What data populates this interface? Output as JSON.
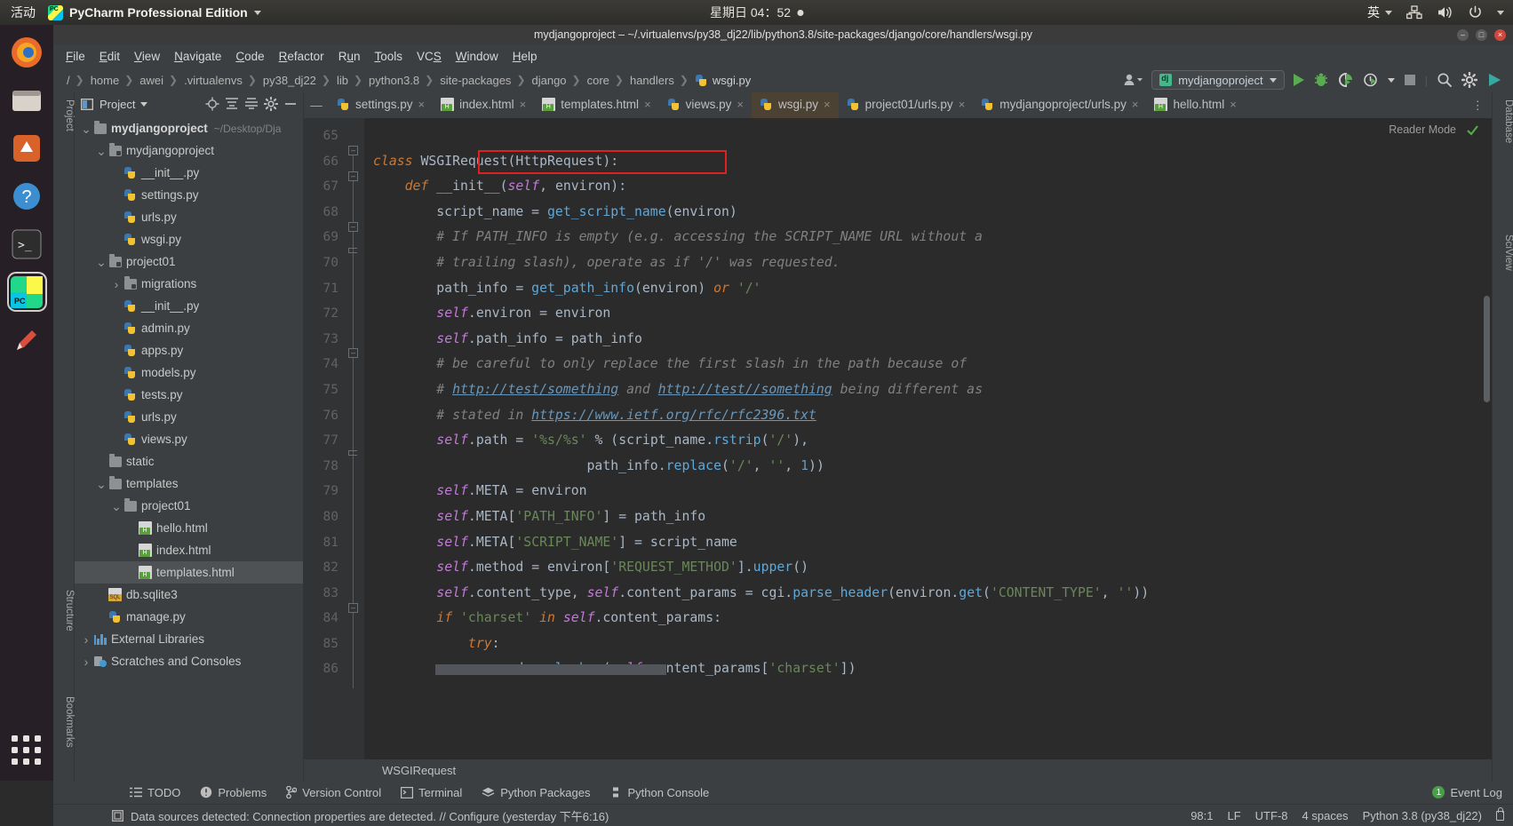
{
  "gnome_panel": {
    "activities": "活动",
    "app_name": "PyCharm Professional Edition",
    "app_icon": "pycharm-logo-icon",
    "clock": "星期日 04：52",
    "ime": "英",
    "network_icon": "network-icon",
    "volume_icon": "volume-icon",
    "power_icon": "power-icon"
  },
  "dock": {
    "items": [
      {
        "name": "firefox",
        "icon": "firefox-icon"
      },
      {
        "name": "files",
        "icon": "files-icon"
      },
      {
        "name": "software",
        "icon": "ubuntu-software-icon"
      },
      {
        "name": "help",
        "icon": "help-icon"
      },
      {
        "name": "terminal",
        "icon": "terminal-icon"
      },
      {
        "name": "pycharm",
        "icon": "pycharm-icon"
      },
      {
        "name": "text-editor",
        "icon": "text-editor-icon"
      }
    ],
    "show_apps_label": "show-applications"
  },
  "window": {
    "title": "mydjangoproject – ~/.virtualenvs/py38_dj22/lib/python3.8/site-packages/django/core/handlers/wsgi.py",
    "minimize": "–",
    "maximize": "□",
    "close": "×"
  },
  "menubar": {
    "items": [
      "File",
      "Edit",
      "View",
      "Navigate",
      "Code",
      "Refactor",
      "Run",
      "Tools",
      "VCS",
      "Window",
      "Help"
    ]
  },
  "navbar": {
    "crumbs": [
      {
        "label": "/",
        "icon": ""
      },
      {
        "label": "home",
        "icon": ""
      },
      {
        "label": "awei",
        "icon": ""
      },
      {
        "label": ".virtualenvs",
        "icon": ""
      },
      {
        "label": "py38_dj22",
        "icon": ""
      },
      {
        "label": "lib",
        "icon": ""
      },
      {
        "label": "python3.8",
        "icon": ""
      },
      {
        "label": "site-packages",
        "icon": ""
      },
      {
        "label": "django",
        "icon": ""
      },
      {
        "label": "core",
        "icon": ""
      },
      {
        "label": "handlers",
        "icon": ""
      },
      {
        "label": "wsgi.py",
        "icon": "python-file-icon"
      }
    ],
    "run_config": "mydjangoproject",
    "run_config_icon": "django-icon",
    "buttons": [
      {
        "name": "user-icon",
        "label": ""
      },
      {
        "name": "run-button",
        "label": ""
      },
      {
        "name": "debug-button",
        "label": ""
      },
      {
        "name": "coverage-button",
        "label": ""
      },
      {
        "name": "profile-button",
        "label": ""
      },
      {
        "name": "stop-button",
        "label": ""
      },
      {
        "name": "search-button",
        "label": ""
      },
      {
        "name": "settings-button",
        "label": ""
      },
      {
        "name": "updates-button",
        "label": ""
      }
    ]
  },
  "project_panel": {
    "title": "Project",
    "toolbar_icons": [
      "locate-icon",
      "expand-all-icon",
      "collapse-all-icon",
      "settings-icon",
      "hide-icon"
    ],
    "tree": [
      {
        "indent": 0,
        "arrow": "v",
        "icon": "folder-icon",
        "label": "mydjangoproject",
        "bold": true,
        "path": "~/Desktop/Dja",
        "selected": false
      },
      {
        "indent": 1,
        "arrow": "v",
        "icon": "folder-src-icon",
        "label": "mydjangoproject",
        "bold": false,
        "path": "",
        "selected": false
      },
      {
        "indent": 2,
        "arrow": "",
        "icon": "python-file-icon",
        "label": "__init__.py",
        "bold": false,
        "path": "",
        "selected": false
      },
      {
        "indent": 2,
        "arrow": "",
        "icon": "python-file-icon",
        "label": "settings.py",
        "bold": false,
        "path": "",
        "selected": false
      },
      {
        "indent": 2,
        "arrow": "",
        "icon": "python-file-icon",
        "label": "urls.py",
        "bold": false,
        "path": "",
        "selected": false
      },
      {
        "indent": 2,
        "arrow": "",
        "icon": "python-file-icon",
        "label": "wsgi.py",
        "bold": false,
        "path": "",
        "selected": false
      },
      {
        "indent": 1,
        "arrow": "v",
        "icon": "folder-src-icon",
        "label": "project01",
        "bold": false,
        "path": "",
        "selected": false
      },
      {
        "indent": 2,
        "arrow": ">",
        "icon": "folder-src-icon",
        "label": "migrations",
        "bold": false,
        "path": "",
        "selected": false
      },
      {
        "indent": 2,
        "arrow": "",
        "icon": "python-file-icon",
        "label": "__init__.py",
        "bold": false,
        "path": "",
        "selected": false
      },
      {
        "indent": 2,
        "arrow": "",
        "icon": "python-file-icon",
        "label": "admin.py",
        "bold": false,
        "path": "",
        "selected": false
      },
      {
        "indent": 2,
        "arrow": "",
        "icon": "python-file-icon",
        "label": "apps.py",
        "bold": false,
        "path": "",
        "selected": false
      },
      {
        "indent": 2,
        "arrow": "",
        "icon": "python-file-icon",
        "label": "models.py",
        "bold": false,
        "path": "",
        "selected": false
      },
      {
        "indent": 2,
        "arrow": "",
        "icon": "python-file-icon",
        "label": "tests.py",
        "bold": false,
        "path": "",
        "selected": false
      },
      {
        "indent": 2,
        "arrow": "",
        "icon": "python-file-icon",
        "label": "urls.py",
        "bold": false,
        "path": "",
        "selected": false
      },
      {
        "indent": 2,
        "arrow": "",
        "icon": "python-file-icon",
        "label": "views.py",
        "bold": false,
        "path": "",
        "selected": false
      },
      {
        "indent": 1,
        "arrow": "",
        "icon": "folder-icon",
        "label": "static",
        "bold": false,
        "path": "",
        "selected": false
      },
      {
        "indent": 1,
        "arrow": "v",
        "icon": "folder-icon",
        "label": "templates",
        "bold": false,
        "path": "",
        "selected": false
      },
      {
        "indent": 2,
        "arrow": "v",
        "icon": "folder-icon",
        "label": "project01",
        "bold": false,
        "path": "",
        "selected": false
      },
      {
        "indent": 3,
        "arrow": "",
        "icon": "html-file-icon",
        "label": "hello.html",
        "bold": false,
        "path": "",
        "selected": false
      },
      {
        "indent": 3,
        "arrow": "",
        "icon": "html-file-icon",
        "label": "index.html",
        "bold": false,
        "path": "",
        "selected": false
      },
      {
        "indent": 3,
        "arrow": "",
        "icon": "html-file-icon",
        "label": "templates.html",
        "bold": false,
        "path": "",
        "selected": true
      },
      {
        "indent": 1,
        "arrow": "",
        "icon": "sqlite-file-icon",
        "label": "db.sqlite3",
        "bold": false,
        "path": "",
        "selected": false
      },
      {
        "indent": 1,
        "arrow": "",
        "icon": "python-file-icon",
        "label": "manage.py",
        "bold": false,
        "path": "",
        "selected": false
      },
      {
        "indent": 0,
        "arrow": ">",
        "icon": "library-icon",
        "label": "External Libraries",
        "bold": false,
        "path": "",
        "selected": false
      },
      {
        "indent": 0,
        "arrow": ">",
        "icon": "scratches-icon",
        "label": "Scratches and Consoles",
        "bold": false,
        "path": "",
        "selected": false
      }
    ]
  },
  "left_strip_labels": [
    "Project",
    "Structure",
    "Bookmarks"
  ],
  "right_strip_labels": [
    "Database",
    "SciView"
  ],
  "editor": {
    "tabs": [
      {
        "label": "settings.py",
        "icon": "python-file-icon",
        "state": "normal"
      },
      {
        "label": "index.html",
        "icon": "html-file-icon",
        "state": "normal"
      },
      {
        "label": "templates.html",
        "icon": "html-file-icon",
        "state": "normal"
      },
      {
        "label": "views.py",
        "icon": "python-file-icon",
        "state": "normal"
      },
      {
        "label": "wsgi.py",
        "icon": "python-file-icon",
        "state": "current"
      },
      {
        "label": "project01/urls.py",
        "icon": "python-file-icon",
        "state": "normal"
      },
      {
        "label": "mydjangoproject/urls.py",
        "icon": "python-file-icon",
        "state": "normal"
      },
      {
        "label": "hello.html",
        "icon": "html-file-icon",
        "state": "normal"
      }
    ],
    "reader_mode": "Reader Mode",
    "first_line_number": 65,
    "lines": [
      {
        "n": 65,
        "tokens": []
      },
      {
        "n": 66,
        "tokens": [
          {
            "t": "class ",
            "c": "kwi"
          },
          {
            "t": "WSGIRequest",
            "c": "pl"
          },
          {
            "t": "(",
            "c": "pl"
          },
          {
            "t": "HttpRequest",
            "c": "pl"
          },
          {
            "t": "):",
            "c": "pl"
          }
        ]
      },
      {
        "n": 67,
        "tokens": [
          {
            "t": "    ",
            "c": "pl"
          },
          {
            "t": "def ",
            "c": "kwi"
          },
          {
            "t": "__init__",
            "c": "pl"
          },
          {
            "t": "(",
            "c": "pl"
          },
          {
            "t": "self",
            "c": "self"
          },
          {
            "t": ", environ):",
            "c": "pl"
          }
        ]
      },
      {
        "n": 68,
        "tokens": [
          {
            "t": "        script_name = ",
            "c": "pl"
          },
          {
            "t": "get_script_name",
            "c": "fn"
          },
          {
            "t": "(environ)",
            "c": "pl"
          }
        ]
      },
      {
        "n": 69,
        "tokens": [
          {
            "t": "        # If PATH_INFO is empty (e.g. accessing the SCRIPT_NAME URL without a",
            "c": "cm"
          }
        ]
      },
      {
        "n": 70,
        "tokens": [
          {
            "t": "        # trailing slash), operate as if '/' was requested.",
            "c": "cm"
          }
        ]
      },
      {
        "n": 71,
        "tokens": [
          {
            "t": "        path_info = ",
            "c": "pl"
          },
          {
            "t": "get_path_info",
            "c": "fn"
          },
          {
            "t": "(environ) ",
            "c": "pl"
          },
          {
            "t": "or ",
            "c": "kwi"
          },
          {
            "t": "'/'",
            "c": "str"
          }
        ]
      },
      {
        "n": 72,
        "tokens": [
          {
            "t": "        ",
            "c": "pl"
          },
          {
            "t": "self",
            "c": "self"
          },
          {
            "t": ".environ = environ",
            "c": "pl"
          }
        ]
      },
      {
        "n": 73,
        "tokens": [
          {
            "t": "        ",
            "c": "pl"
          },
          {
            "t": "self",
            "c": "self"
          },
          {
            "t": ".path_info = path_info",
            "c": "pl"
          }
        ]
      },
      {
        "n": 74,
        "tokens": [
          {
            "t": "        # be careful to only replace the first slash in the path because of",
            "c": "cm"
          }
        ]
      },
      {
        "n": 75,
        "tokens": [
          {
            "t": "        # ",
            "c": "cm"
          },
          {
            "t": "http://test/something",
            "c": "lnk"
          },
          {
            "t": " and ",
            "c": "cm"
          },
          {
            "t": "http://test//something",
            "c": "lnk"
          },
          {
            "t": " being different as",
            "c": "cm"
          }
        ]
      },
      {
        "n": 76,
        "tokens": [
          {
            "t": "        # stated in ",
            "c": "cm"
          },
          {
            "t": "https://www.ietf.org/rfc/rfc2396.txt",
            "c": "lnk"
          }
        ]
      },
      {
        "n": 77,
        "tokens": [
          {
            "t": "        ",
            "c": "pl"
          },
          {
            "t": "self",
            "c": "self"
          },
          {
            "t": ".path = ",
            "c": "pl"
          },
          {
            "t": "'%s/%s'",
            "c": "str"
          },
          {
            "t": " % (script_name.",
            "c": "pl"
          },
          {
            "t": "rstrip",
            "c": "fn"
          },
          {
            "t": "(",
            "c": "pl"
          },
          {
            "t": "'/'",
            "c": "str"
          },
          {
            "t": "),",
            "c": "pl"
          }
        ]
      },
      {
        "n": 78,
        "tokens": [
          {
            "t": "                           path_info.",
            "c": "pl"
          },
          {
            "t": "replace",
            "c": "fn"
          },
          {
            "t": "(",
            "c": "pl"
          },
          {
            "t": "'/'",
            "c": "str"
          },
          {
            "t": ", ",
            "c": "pl"
          },
          {
            "t": "''",
            "c": "str"
          },
          {
            "t": ", ",
            "c": "pl"
          },
          {
            "t": "1",
            "c": "num"
          },
          {
            "t": "))",
            "c": "pl"
          }
        ]
      },
      {
        "n": 79,
        "tokens": [
          {
            "t": "        ",
            "c": "pl"
          },
          {
            "t": "self",
            "c": "self"
          },
          {
            "t": ".META = environ",
            "c": "pl"
          }
        ]
      },
      {
        "n": 80,
        "tokens": [
          {
            "t": "        ",
            "c": "pl"
          },
          {
            "t": "self",
            "c": "self"
          },
          {
            "t": ".META[",
            "c": "pl"
          },
          {
            "t": "'PATH_INFO'",
            "c": "str"
          },
          {
            "t": "] = path_info",
            "c": "pl"
          }
        ]
      },
      {
        "n": 81,
        "tokens": [
          {
            "t": "        ",
            "c": "pl"
          },
          {
            "t": "self",
            "c": "self"
          },
          {
            "t": ".META[",
            "c": "pl"
          },
          {
            "t": "'SCRIPT_NAME'",
            "c": "str"
          },
          {
            "t": "] = script_name",
            "c": "pl"
          }
        ]
      },
      {
        "n": 82,
        "tokens": [
          {
            "t": "        ",
            "c": "pl"
          },
          {
            "t": "self",
            "c": "self"
          },
          {
            "t": ".method = environ[",
            "c": "pl"
          },
          {
            "t": "'REQUEST_METHOD'",
            "c": "str"
          },
          {
            "t": "].",
            "c": "pl"
          },
          {
            "t": "upper",
            "c": "fn"
          },
          {
            "t": "()",
            "c": "pl"
          }
        ]
      },
      {
        "n": 83,
        "tokens": [
          {
            "t": "        ",
            "c": "pl"
          },
          {
            "t": "self",
            "c": "self"
          },
          {
            "t": ".content_type, ",
            "c": "pl"
          },
          {
            "t": "self",
            "c": "self"
          },
          {
            "t": ".content_params = cgi.",
            "c": "pl"
          },
          {
            "t": "parse_header",
            "c": "fn"
          },
          {
            "t": "(environ.",
            "c": "pl"
          },
          {
            "t": "get",
            "c": "fn"
          },
          {
            "t": "(",
            "c": "pl"
          },
          {
            "t": "'CONTENT_TYPE'",
            "c": "str"
          },
          {
            "t": ", ",
            "c": "pl"
          },
          {
            "t": "''",
            "c": "str"
          },
          {
            "t": "))",
            "c": "pl"
          }
        ]
      },
      {
        "n": 84,
        "tokens": [
          {
            "t": "        ",
            "c": "pl"
          },
          {
            "t": "if ",
            "c": "kwi"
          },
          {
            "t": "'charset' ",
            "c": "str"
          },
          {
            "t": "in ",
            "c": "kwi"
          },
          {
            "t": "self",
            "c": "self"
          },
          {
            "t": ".content_params:",
            "c": "pl"
          }
        ]
      },
      {
        "n": 85,
        "tokens": [
          {
            "t": "            ",
            "c": "pl"
          },
          {
            "t": "try",
            "c": "kwi"
          },
          {
            "t": ":",
            "c": "pl"
          }
        ]
      },
      {
        "n": 86,
        "tokens": [
          {
            "t": "                codecs.",
            "c": "pl"
          },
          {
            "t": "lookup",
            "c": "fn"
          },
          {
            "t": "(",
            "c": "pl"
          },
          {
            "t": "self",
            "c": "self"
          },
          {
            "t": ".content_params[",
            "c": "pl"
          },
          {
            "t": "'charset'",
            "c": "str"
          },
          {
            "t": "])",
            "c": "pl"
          }
        ]
      }
    ],
    "annotation": {
      "name": "red-highlight-box",
      "text": "WSGIRequest(HttpRequest):",
      "color": "#e02020"
    },
    "breadcrumb_bottom": "WSGIRequest"
  },
  "tool_window_bar": {
    "items": [
      {
        "label": "TODO",
        "icon": "todo-icon"
      },
      {
        "label": "Problems",
        "icon": "problems-icon"
      },
      {
        "label": "Version Control",
        "icon": "vcs-icon"
      },
      {
        "label": "Terminal",
        "icon": "terminal-icon"
      },
      {
        "label": "Python Packages",
        "icon": "packages-icon"
      },
      {
        "label": "Python Console",
        "icon": "python-console-icon"
      }
    ],
    "event_log": {
      "label": "Event Log",
      "count": "1"
    }
  },
  "statusbar": {
    "message": "Data sources detected: Connection properties are detected. // Configure (yesterday 下午6:16)",
    "message_icon": "database-icon",
    "caret": "98:1",
    "line_sep": "LF",
    "encoding": "UTF-8",
    "indent": "4 spaces",
    "interpreter": "Python 3.8 (py38_dj22)",
    "lock_icon": "lock-icon"
  },
  "colors": {
    "accent_green": "#5aab52",
    "annotation_red": "#e02020",
    "editor_bg": "#2b2b2b",
    "panel_bg": "#3c3f41"
  }
}
